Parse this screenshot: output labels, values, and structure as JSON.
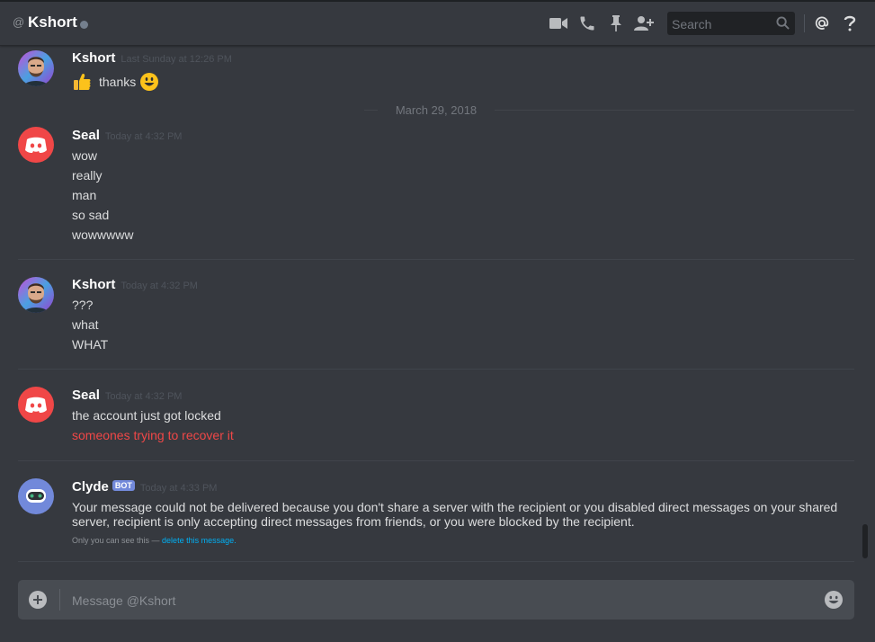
{
  "header": {
    "at_symbol": "@",
    "channel_name": "Kshort",
    "search_placeholder": "Search",
    "icons": [
      "video-call-icon",
      "voice-call-icon",
      "pin-icon",
      "add-friend-icon",
      "search-icon",
      "mention-icon",
      "help-icon"
    ]
  },
  "messages": {
    "first": {
      "author": "Kshort",
      "timestamp": "Last Sunday at 12:26 PM",
      "lines": [
        "thanks"
      ]
    },
    "date_divider": "March 29, 2018",
    "seal1": {
      "author": "Seal",
      "timestamp": "Today at 4:32 PM",
      "lines": [
        "wow",
        "really",
        "man",
        "so sad",
        "wowwwww"
      ]
    },
    "kshort2": {
      "author": "Kshort",
      "timestamp": "Today at 4:32 PM",
      "lines": [
        "???",
        "what",
        "WHAT"
      ]
    },
    "seal2": {
      "author": "Seal",
      "timestamp": "Today at 4:32 PM",
      "lines": [
        "the account just got locked",
        "someones trying to recover it"
      ]
    },
    "clyde": {
      "author": "Clyde",
      "badge": "BOT",
      "timestamp": "Today at 4:33 PM",
      "lines": [
        "Your message could not be delivered because you don't share a server with the recipient or you disabled direct messages on your shared",
        "server, recipient is only accepting direct messages from friends, or you were blocked by the recipient."
      ],
      "ephemeral_note": "Only you can see this — ",
      "delete_link": "delete this message."
    }
  },
  "composer": {
    "placeholder": "Message @Kshort"
  },
  "colors": {
    "background": "#36393f",
    "error_text": "#f04747",
    "bot_badge": "#7289da",
    "link": "#00b0f4",
    "discord_red_avatar": "#f04747",
    "clyde_avatar": "#7289da"
  }
}
